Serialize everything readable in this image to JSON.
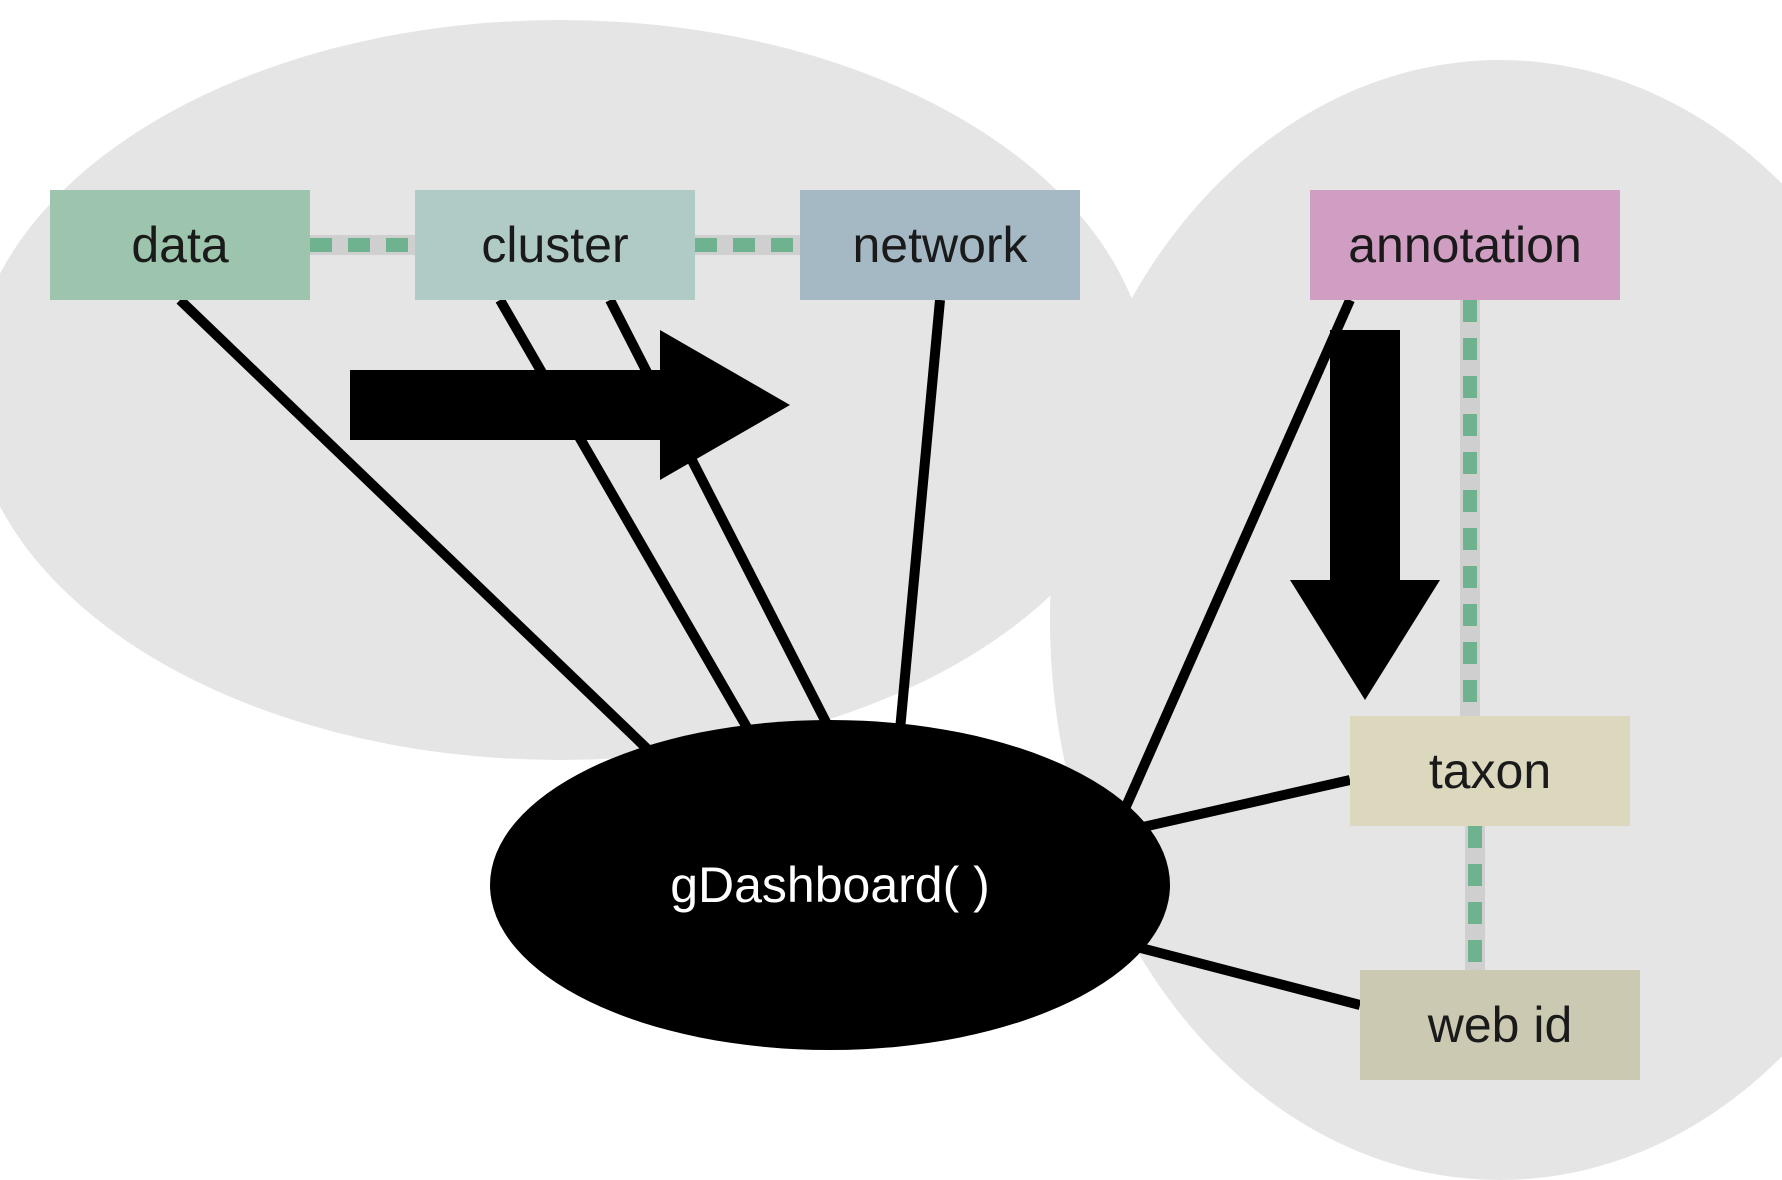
{
  "nodes": {
    "data": "data",
    "cluster": "cluster",
    "network": "network",
    "annotation": "annotation",
    "taxon": "taxon",
    "webid": "web id"
  },
  "center": "gDashboard( )",
  "colors": {
    "data": "#9dc4ac",
    "cluster": "#b0cbc5",
    "network": "#a5b9c5",
    "annotation": "#d19ec3",
    "taxon": "#dbd8bd",
    "webid": "#ccc9b2",
    "bg": "#e5e5e5",
    "center": "#000000",
    "dash": "#6eb28f",
    "dash_bg": "#cfcfcf"
  }
}
